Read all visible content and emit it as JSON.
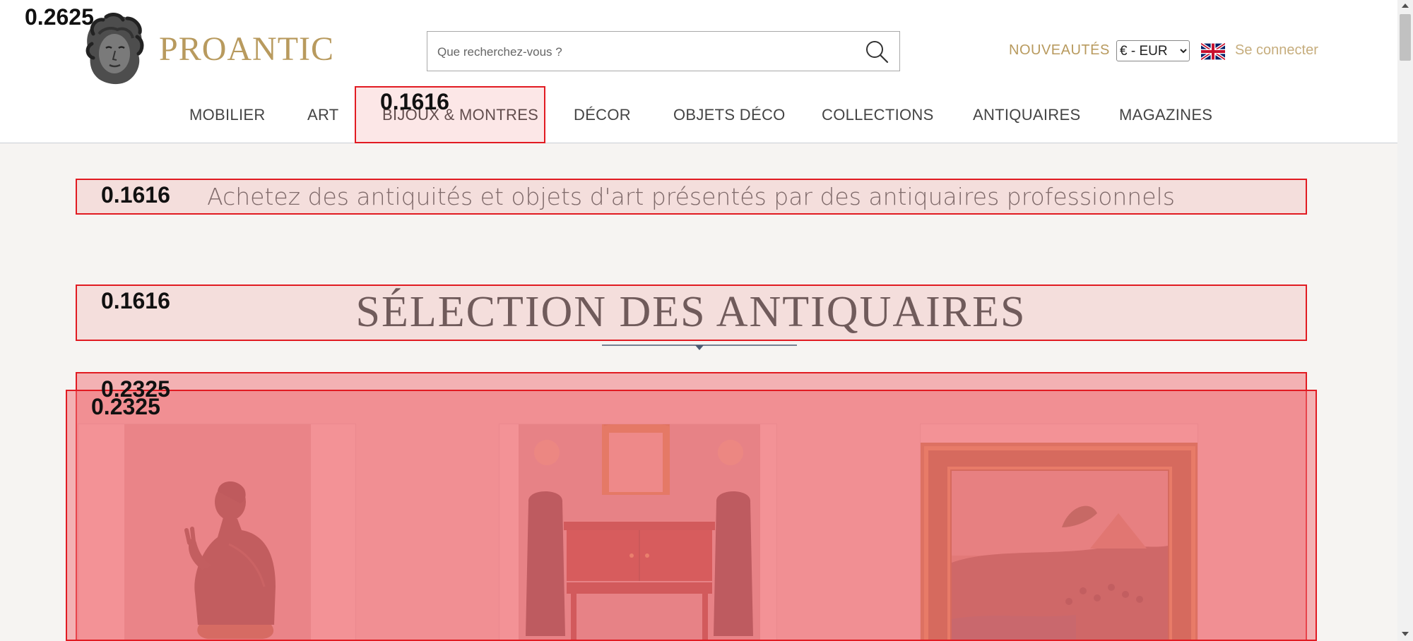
{
  "brand": {
    "name": "PROANTIC"
  },
  "search": {
    "placeholder": "Que recherchez-vous ?"
  },
  "header_links": {
    "nouveautes": "NOUVEAUTÉS",
    "currency_selected": "€ - EUR",
    "login": "Se connecter"
  },
  "nav": {
    "items": [
      {
        "label": "MOBILIER"
      },
      {
        "label": "ART"
      },
      {
        "label": "BIJOUX & MONTRES"
      },
      {
        "label": "DÉCOR"
      },
      {
        "label": "OBJETS DÉCO"
      },
      {
        "label": "COLLECTIONS"
      },
      {
        "label": "ANTIQUAIRES"
      },
      {
        "label": "MAGAZINES"
      }
    ]
  },
  "main": {
    "tagline": "Achetez des antiquités et objets d'art présentés par des antiquaires professionnels",
    "section_title": "SÉLECTION DES ANTIQUAIRES",
    "cards": [
      {
        "subject": "bronze-bust"
      },
      {
        "subject": "mahogany-console"
      },
      {
        "subject": "framed-painting"
      }
    ]
  },
  "annotations": {
    "labels": [
      "0.2625",
      "0.1616",
      "0.1616",
      "0.1616",
      "0.2325",
      "0.2325"
    ]
  },
  "colors": {
    "brand_gold": "#b89a5e",
    "login_gold": "#c6ad7d",
    "overlay_red": "#e11b22",
    "background": "#f6f4f2"
  },
  "icons": [
    "logo-head-icon",
    "search-icon",
    "uk-flag-icon",
    "chevron-icon"
  ]
}
